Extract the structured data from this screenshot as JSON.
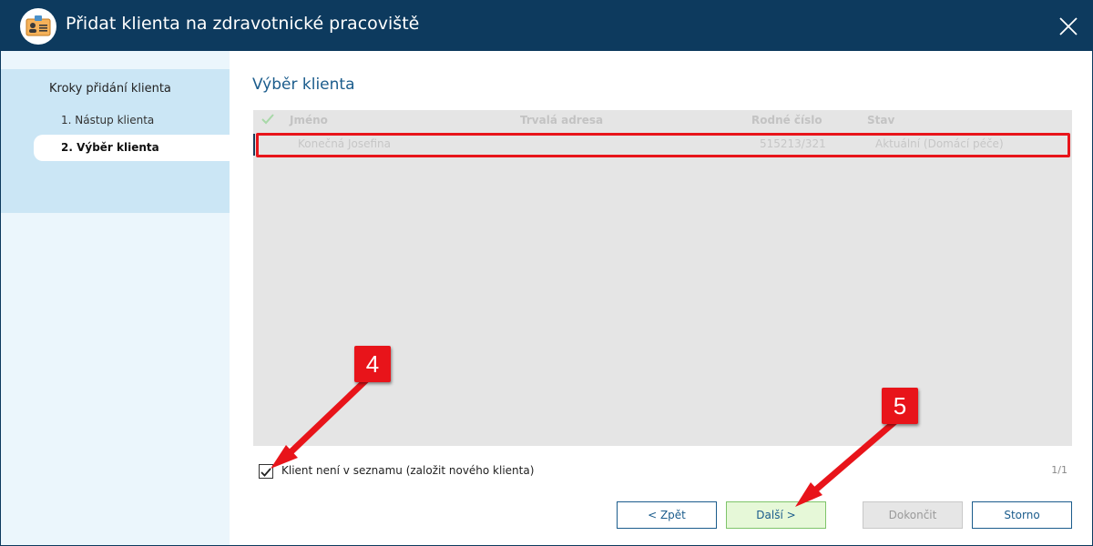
{
  "window": {
    "title": "Přidat klienta na zdravotnické pracoviště"
  },
  "sidebar": {
    "title": "Kroky přidání klienta",
    "steps": [
      {
        "label": "1. Nástup klienta",
        "active": false
      },
      {
        "label": "2. Výběr klienta",
        "active": true
      }
    ]
  },
  "main": {
    "title": "Výběr klienta",
    "grid": {
      "columns": [
        "Jméno",
        "Trvalá adresa",
        "Rodné číslo",
        "Stav"
      ],
      "rows": [
        {
          "name": "Konečná Josefina",
          "address": "",
          "birth_number": "515213/321",
          "status": "Aktuální (Domácí péče)"
        }
      ]
    },
    "new_client_checkbox": {
      "label": "Klient není v seznamu (založit nového klienta)",
      "checked": true
    },
    "page_count": "1/1"
  },
  "buttons": {
    "back": "< Zpět",
    "next": "Další >",
    "finish": "Dokončit",
    "cancel": "Storno"
  },
  "callouts": [
    "4",
    "5"
  ],
  "colors": {
    "titlebar": "#0d3a5e",
    "accent": "#1b5c8c",
    "highlight": "#e8141a",
    "next_button_bg": "#e6f8d8"
  },
  "icons": {
    "app": "client-card-icon",
    "close": "close-icon",
    "grid_check": "check-icon",
    "checkbox": "checkmark-icon"
  }
}
